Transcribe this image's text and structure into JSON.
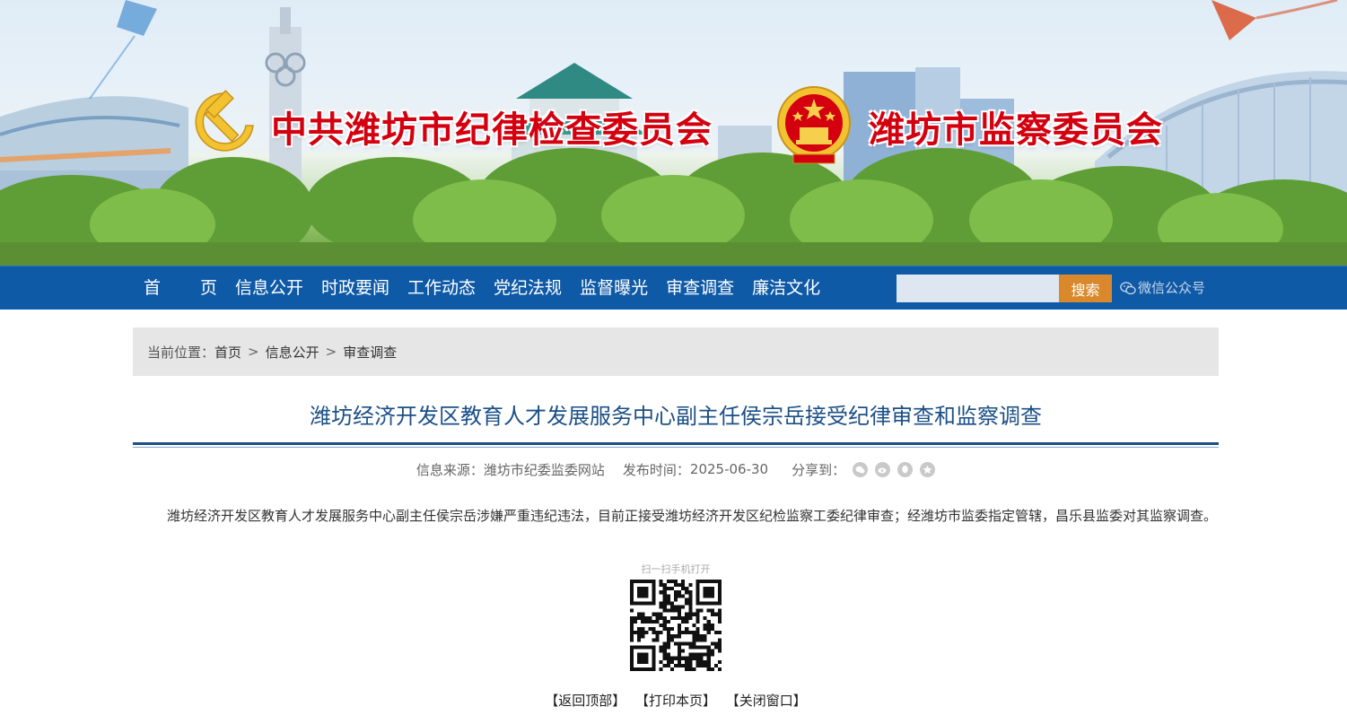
{
  "banner": {
    "title_left": "中共潍坊市纪律检查委员会",
    "title_right": "潍坊市监察委员会",
    "party_emblem": "hammer-sickle-emblem",
    "state_emblem": "national-emblem",
    "accent_color": "#d4000f"
  },
  "nav": {
    "home_left": "首",
    "home_right": "页",
    "items": [
      "信息公开",
      "时政要闻",
      "工作动态",
      "党纪法规",
      "监督曝光",
      "审查调查",
      "廉洁文化"
    ],
    "search_placeholder": "",
    "search_label": "搜索",
    "wechat_label": "微信公众号",
    "background_color": "#0f5aa6",
    "search_button_color": "#d9892b"
  },
  "breadcrumb": {
    "prefix": "当前位置：",
    "items": [
      "首页",
      "信息公开",
      "审查调查"
    ],
    "separator": ">"
  },
  "article": {
    "title": "潍坊经济开发区教育人才发展服务中心副主任侯宗岳接受纪律审查和监察调查",
    "source_label": "信息来源：",
    "source": "潍坊市纪委监委网站",
    "date_label": "发布时间：",
    "date": "2025-06-30",
    "share_label": "分享到：",
    "share_icons": [
      "wechat-icon",
      "weibo-icon",
      "qq-icon",
      "qzone-icon"
    ],
    "body": "潍坊经济开发区教育人才发展服务中心副主任侯宗岳涉嫌严重违纪违法，目前正接受潍坊经济开发区纪检监察工委纪律审查；经潍坊市监委指定管辖，昌乐县监委对其监察调查。",
    "title_color": "#1b4f86"
  },
  "qr": {
    "caption": "扫一扫手机打开"
  },
  "footer": {
    "back_to_top": "【返回顶部】",
    "print": "【打印本页】",
    "close": "【关闭窗口】"
  }
}
